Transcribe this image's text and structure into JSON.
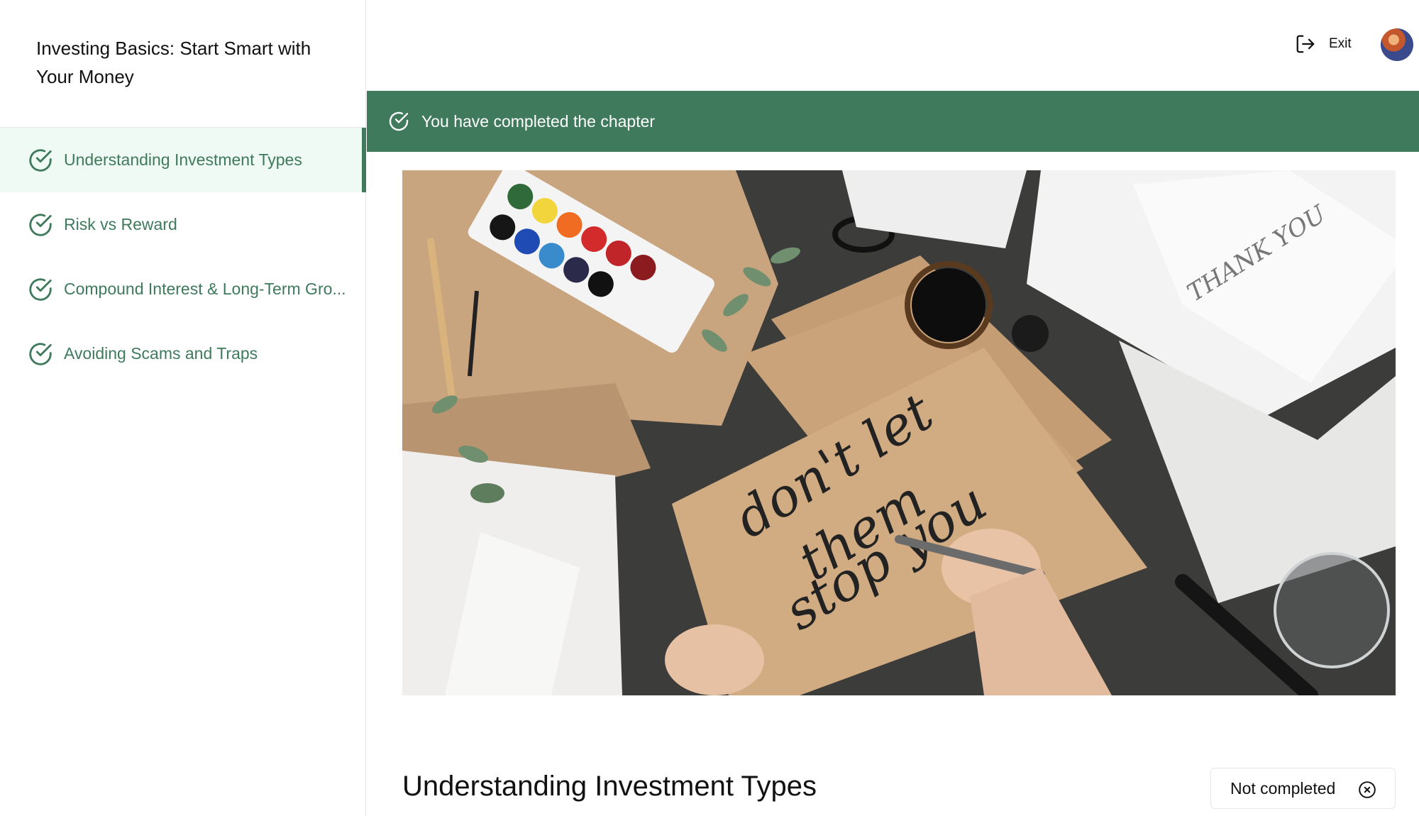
{
  "course": {
    "title": "Investing Basics: Start Smart with Your Money"
  },
  "chapters": [
    {
      "label": "Understanding Investment Types",
      "active": true,
      "completed": true
    },
    {
      "label": "Risk vs Reward",
      "active": false,
      "completed": true
    },
    {
      "label": "Compound Interest & Long-Term Gro...",
      "active": false,
      "completed": true
    },
    {
      "label": "Avoiding Scams and Traps",
      "active": false,
      "completed": true
    }
  ],
  "topbar": {
    "exit_label": "Exit",
    "exit_icon": "log-out-icon",
    "avatar_icon": "user-avatar"
  },
  "banner": {
    "text": "You have completed the chapter",
    "icon": "check-circle-icon",
    "color": "#3f7a5c"
  },
  "hero": {
    "handwriting": [
      "don't let",
      "them",
      "stop you"
    ],
    "card_text": "THANK YOU"
  },
  "main": {
    "heading": "Understanding Investment Types",
    "status_label": "Not completed",
    "status_icon": "x-circle-icon"
  },
  "colors": {
    "accent": "#3f7a5c",
    "active_bg": "#f0faf4"
  }
}
